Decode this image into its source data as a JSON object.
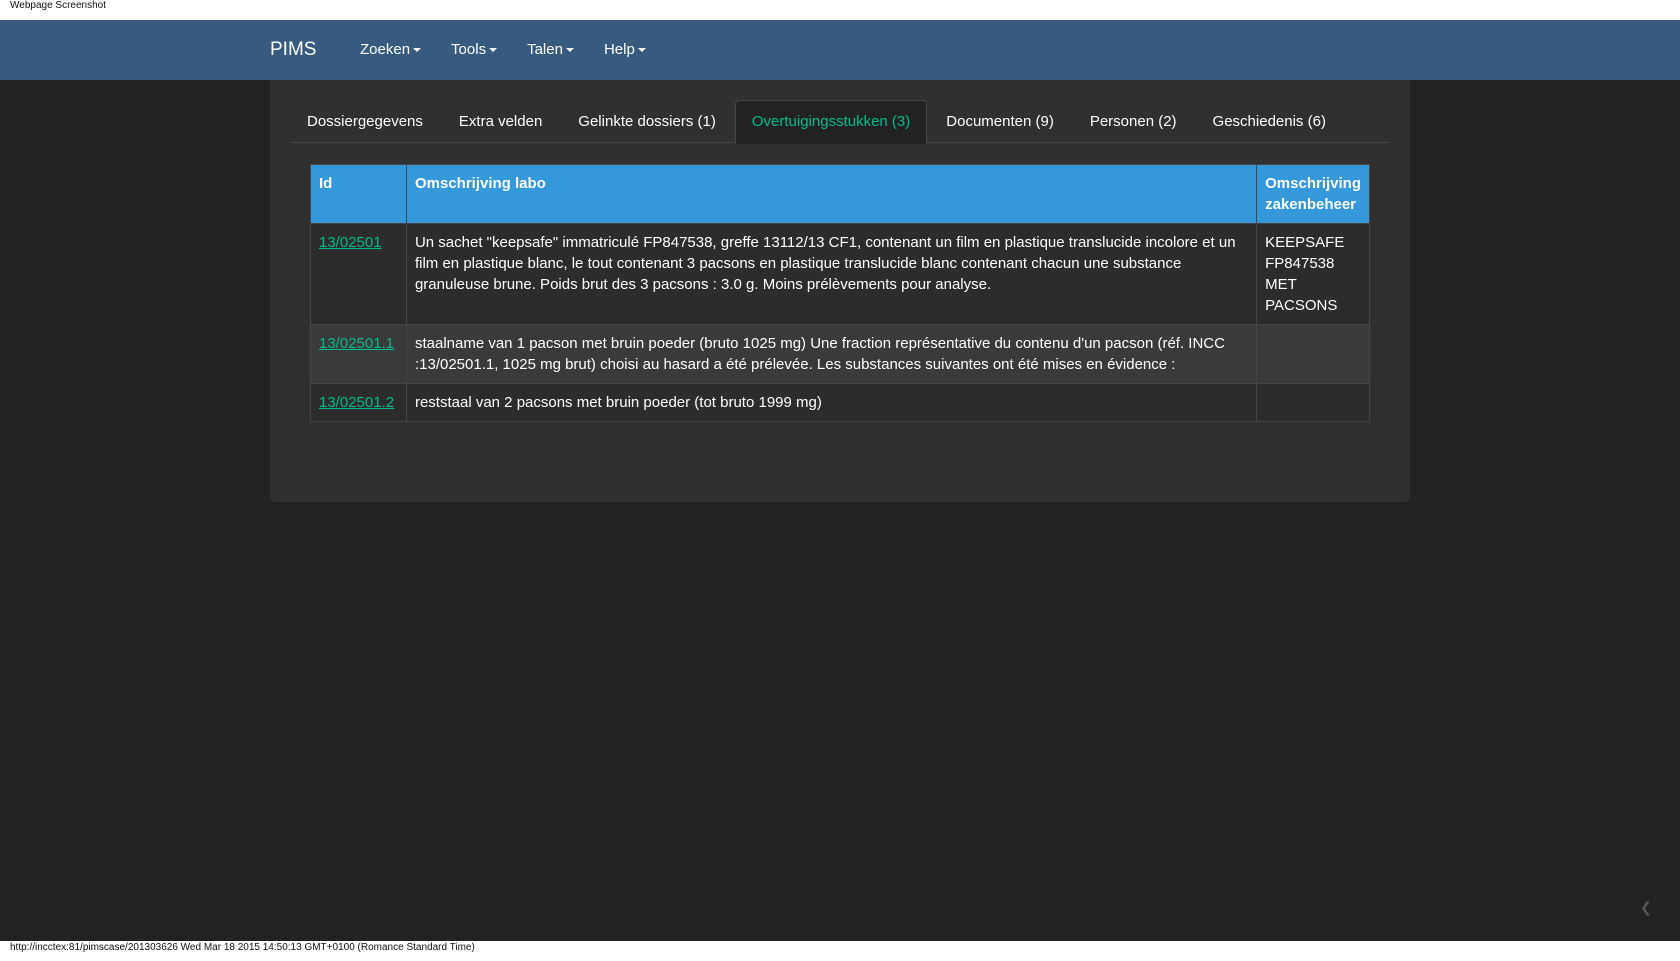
{
  "window": {
    "caption": "Webpage Screenshot"
  },
  "navbar": {
    "brand": "PIMS",
    "menus": [
      {
        "label": "Zoeken"
      },
      {
        "label": "Tools"
      },
      {
        "label": "Talen"
      },
      {
        "label": "Help"
      }
    ]
  },
  "tabs": [
    {
      "label": "Dossiergegevens",
      "active": false
    },
    {
      "label": "Extra velden",
      "active": false
    },
    {
      "label": "Gelinkte dossiers (1)",
      "active": false
    },
    {
      "label": "Overtuigingsstukken (3)",
      "active": true
    },
    {
      "label": "Documenten (9)",
      "active": false
    },
    {
      "label": "Personen (2)",
      "active": false
    },
    {
      "label": "Geschiedenis (6)",
      "active": false
    }
  ],
  "table": {
    "headers": {
      "id": "Id",
      "labo": "Omschrijving labo",
      "zakenbeheer": "Omschrijving zakenbeheer"
    },
    "rows": [
      {
        "id": "13/02501",
        "labo": "Un sachet \"keepsafe\" immatriculé FP847538, greffe 13112/13 CF1, contenant un film en plastique translucide incolore et un film en plastique blanc, le tout contenant 3 pacsons en plastique translucide blanc contenant chacun une substance granuleuse brune. Poids brut des 3 pacsons : 3.0 g. Moins prélèvements pour analyse.",
        "zakenbeheer": "KEEPSAFE FP847538 MET PACSONS"
      },
      {
        "id": "13/02501.1",
        "labo": "staalname van 1 pacson met bruin poeder (bruto 1025 mg) Une fraction représentative du contenu d'un pacson (réf. INCC :13/02501.1, 1025 mg brut) choisi au hasard a été prélevée. Les substances suivantes ont été mises en évidence :",
        "zakenbeheer": ""
      },
      {
        "id": "13/02501.2",
        "labo": "reststaal van 2 pacsons met bruin poeder (tot bruto 1999 mg)",
        "zakenbeheer": ""
      }
    ]
  },
  "status_bar": {
    "text": "http://incctex:81/pimscase/201303626 Wed Mar 18 2015 14:50:13 GMT+0100 (Romance Standard Time)"
  },
  "colors": {
    "navbar": "#375a7f",
    "header": "#3498db",
    "link": "#00bc8c",
    "background": "#222222",
    "panel": "#303030"
  }
}
